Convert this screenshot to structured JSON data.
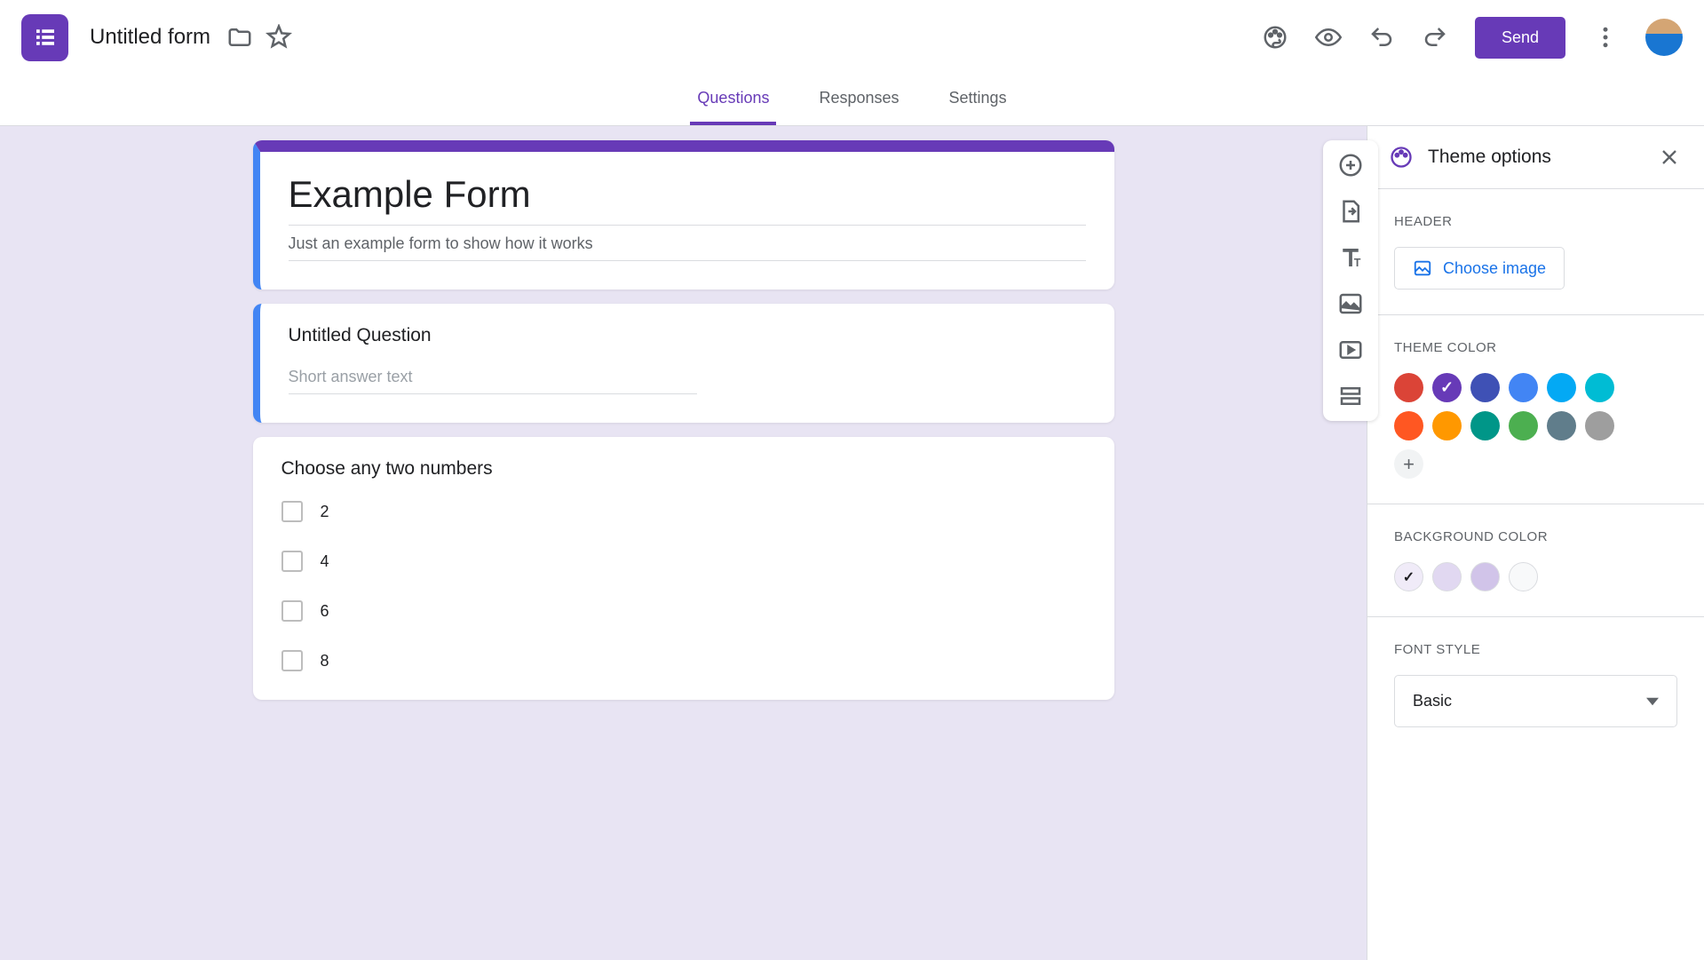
{
  "header": {
    "title": "Untitled form",
    "send_label": "Send"
  },
  "tabs": {
    "questions": "Questions",
    "responses": "Responses",
    "settings": "Settings"
  },
  "form": {
    "heading": "Example Form",
    "description": "Just an example form to show how it works",
    "q1": {
      "title": "Untitled Question",
      "placeholder": "Short answer text"
    },
    "q2": {
      "title": "Choose any two numbers",
      "options": [
        "2",
        "4",
        "6",
        "8"
      ]
    }
  },
  "theme": {
    "panel_title": "Theme options",
    "header_label": "HEADER",
    "choose_image": "Choose image",
    "theme_color_label": "THEME COLOR",
    "theme_colors": [
      "#db4437",
      "#673ab7",
      "#3f51b5",
      "#4285f4",
      "#03a9f4",
      "#00bcd4",
      "#ff5722",
      "#ff9800",
      "#009688",
      "#4caf50",
      "#607d8b",
      "#9e9e9e"
    ],
    "selected_theme_color": 1,
    "bg_color_label": "BACKGROUND COLOR",
    "bg_colors": [
      "#f0ebf8",
      "#e1d8f1",
      "#d1c4e9",
      "#f8f9fa"
    ],
    "selected_bg_color": 0,
    "font_label": "FONT STYLE",
    "font_value": "Basic"
  }
}
